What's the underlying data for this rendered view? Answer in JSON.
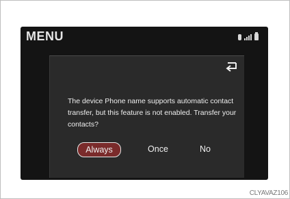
{
  "screen": {
    "title": "MENU",
    "status_icons": [
      "bluetooth-icon",
      "signal-icon",
      "battery-icon"
    ]
  },
  "dialog": {
    "back_icon": "back-arrow-icon",
    "message": "The device Phone name supports automatic contact transfer, but this feature is not enabled. Transfer your contacts?",
    "options": [
      "Always",
      "Once",
      "No"
    ],
    "selected_option": "Always"
  },
  "caption": "CLYAVAZ106",
  "colors": {
    "screen_bg": "#141414",
    "dialog_bg": "#2a2a2a",
    "selected_option_bg": "#7a2b2b"
  }
}
